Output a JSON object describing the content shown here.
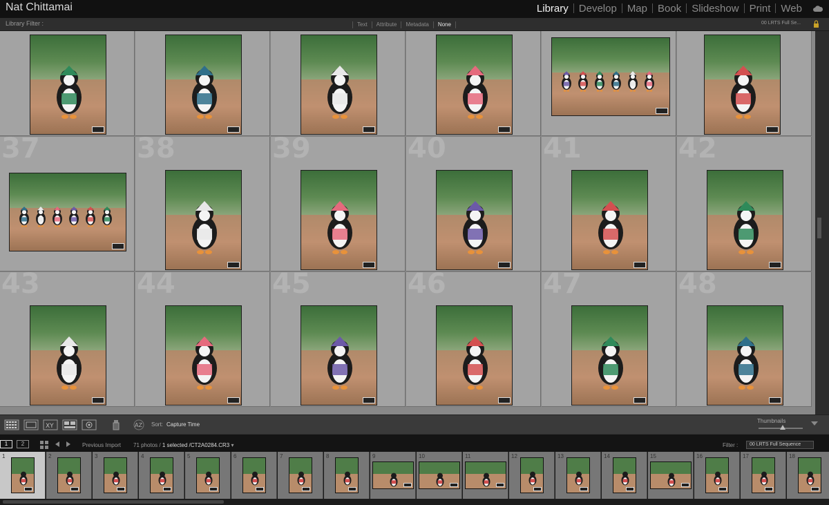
{
  "identity": "Nat Chittamai",
  "modules": [
    {
      "label": "Library",
      "active": true
    },
    {
      "label": "Develop",
      "active": false
    },
    {
      "label": "Map",
      "active": false
    },
    {
      "label": "Book",
      "active": false
    },
    {
      "label": "Slideshow",
      "active": false
    },
    {
      "label": "Print",
      "active": false
    },
    {
      "label": "Web",
      "active": false
    }
  ],
  "cloud_icon": "cloud-icon",
  "filter_bar": {
    "title": "Library Filter :",
    "options": [
      {
        "label": "Text",
        "active": false
      },
      {
        "label": "Attribute",
        "active": false
      },
      {
        "label": "Metadata",
        "active": false
      },
      {
        "label": "None",
        "active": true
      }
    ],
    "preset": "00 LRTS Full Se...",
    "lock_icon": "lock-icon"
  },
  "grid": {
    "rows": [
      {
        "numbers": [
          "",
          "",
          "",
          "",
          "",
          ""
        ]
      },
      {
        "numbers": [
          "37",
          "38",
          "39",
          "40",
          "41",
          "42"
        ]
      },
      {
        "numbers": [
          "43",
          "44",
          "45",
          "46",
          "47",
          "48"
        ]
      }
    ]
  },
  "toolbar": {
    "sort_label": "Sort:",
    "sort_value": "Capture Time",
    "thumbnails_label": "Thumbnails",
    "thumbnail_size": 0.5
  },
  "filmstrip_header": {
    "page1": "1",
    "page2": "2",
    "source": "Previous Import",
    "count": "71 photos",
    "selected": "1 selected",
    "filename": "/CT2A0284.CR3",
    "filter_label": "Filter :",
    "filter_value": "00 LRTS Full Sequence"
  },
  "filmstrip": {
    "numbers": [
      "1",
      "2",
      "3",
      "4",
      "5",
      "6",
      "7",
      "8",
      "9",
      "10",
      "11",
      "12",
      "13",
      "14",
      "15",
      "16",
      "17",
      "18"
    ],
    "selected_index": 0
  }
}
